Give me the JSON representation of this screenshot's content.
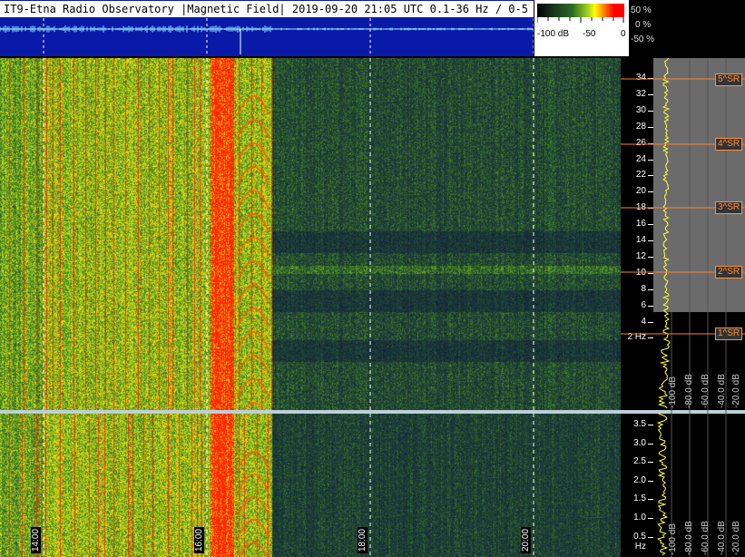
{
  "header": {
    "title": "IT9-Etna Radio Observatory |Magnetic Field| 2019-09-20 21:05 UTC 0.1-36 Hz / 0-5 Hz"
  },
  "scale": {
    "left_label": "-100 dB",
    "mid_label": "-50",
    "right_label": "0",
    "pct_top": "50 %",
    "pct_mid": "0 %",
    "pct_bot": "-50 %"
  },
  "top_axis": {
    "ticks": [
      "34",
      "32",
      "30",
      "28",
      "26",
      "24",
      "22",
      "20",
      "18",
      "16",
      "14",
      "12",
      "10",
      "8",
      "6",
      "4",
      "2 Hz"
    ]
  },
  "bottom_axis": {
    "ticks": [
      "3.5",
      "3.0",
      "2.5",
      "2.0",
      "1.5",
      "1.0",
      "0.5 Hz"
    ]
  },
  "schumann": {
    "labels": [
      "5^SR",
      "4^SR",
      "3^SR",
      "2^SR",
      "1^SR"
    ]
  },
  "profile_db": {
    "labels": [
      "-100 dB",
      "-80.0 dB",
      "-60.0 dB",
      "-40.0 dB",
      "-20.0 dB"
    ]
  },
  "time_axis": {
    "labels": [
      "14:00",
      "16:00",
      "18:00",
      "20:00"
    ]
  },
  "colors": {
    "spec_dark": "#1d2b3a",
    "spec_green": "#3c7a28",
    "spec_yellow": "#e8e020",
    "spec_red": "#ff2a00",
    "sr_line": "#ff8030",
    "profile_trace": "#ffff40"
  }
}
